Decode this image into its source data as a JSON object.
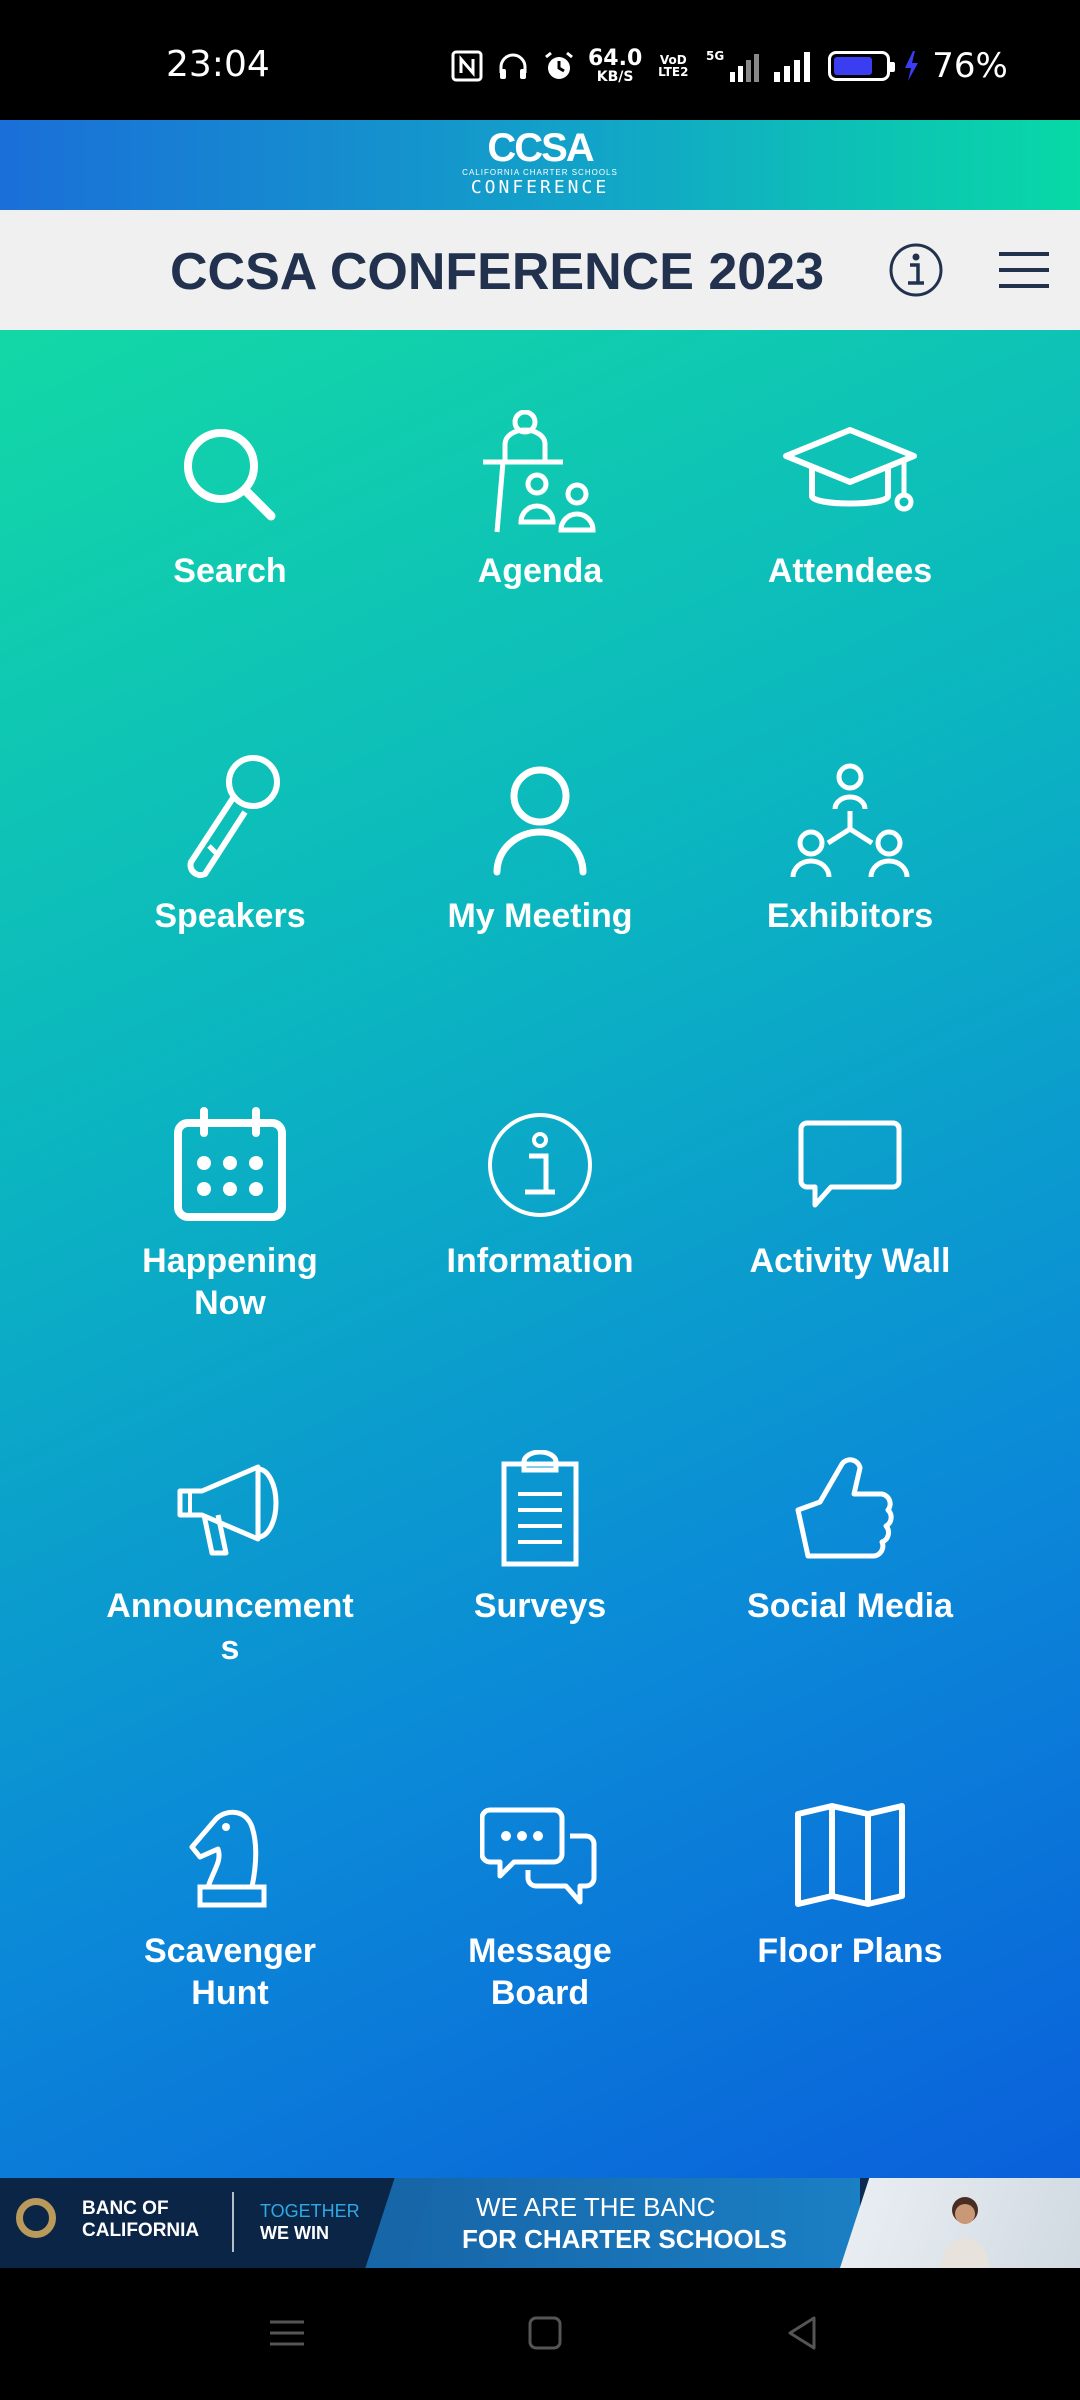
{
  "status": {
    "time": "23:04",
    "net_speed": "64.0",
    "net_unit": "KB/S",
    "volte": "VoD LTE2",
    "network": "5G",
    "battery": "76%",
    "battery_level": 0.76
  },
  "brand": {
    "mark": "CCSA",
    "tagline": "CALIFORNIA CHARTER SCHOOLS",
    "word": "CONFERENCE"
  },
  "header": {
    "title": "CCSA CONFERENCE 2023"
  },
  "tiles": [
    {
      "label": "Search",
      "icon": "search-icon"
    },
    {
      "label": "Agenda",
      "icon": "presenter-icon"
    },
    {
      "label": "Attendees",
      "icon": "graduation-cap-icon"
    },
    {
      "label": "Speakers",
      "icon": "microphone-icon"
    },
    {
      "label": "My Meeting",
      "icon": "person-icon"
    },
    {
      "label": "Exhibitors",
      "icon": "network-people-icon"
    },
    {
      "label": "Happening Now",
      "icon": "calendar-icon"
    },
    {
      "label": "Information",
      "icon": "info-icon"
    },
    {
      "label": "Activity Wall",
      "icon": "chat-bubble-icon"
    },
    {
      "label": "Announcements",
      "icon": "megaphone-icon"
    },
    {
      "label": "Surveys",
      "icon": "clipboard-icon"
    },
    {
      "label": "Social Media",
      "icon": "thumbs-up-icon"
    },
    {
      "label": "Scavenger Hunt",
      "icon": "chess-knight-icon"
    },
    {
      "label": "Message Board",
      "icon": "chat-bubbles-icon"
    },
    {
      "label": "Floor Plans",
      "icon": "map-icon"
    }
  ],
  "ad": {
    "bank_line1": "BANC OF",
    "bank_line2": "CALIFORNIA",
    "together": "TOGETHER",
    "we_win": "WE WIN",
    "headline1": "WE ARE THE BANC",
    "headline2": "FOR CHARTER SCHOOLS"
  },
  "colors": {
    "title": "#22324e",
    "gradient_top": "#13d8a6",
    "gradient_bottom": "#0a60da"
  }
}
